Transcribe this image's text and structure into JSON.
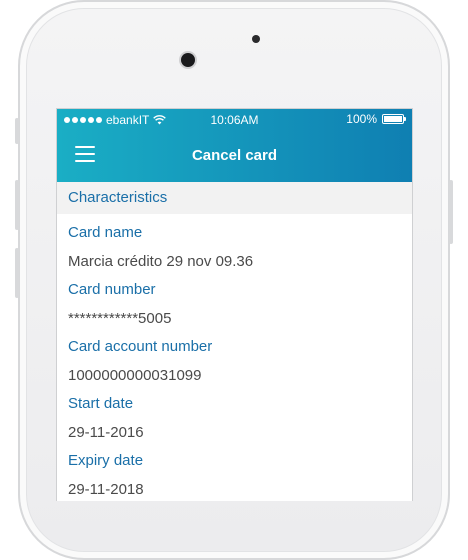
{
  "status_bar": {
    "carrier": "ebankIT",
    "time": "10:06AM",
    "battery_text": "100%",
    "signal_dots": 5,
    "battery_level": 1.0
  },
  "header": {
    "title": "Cancel card",
    "menu_icon": "hamburger-menu-icon",
    "background_color_start": "#1aaec5",
    "background_color_end": "#0f7fb2"
  },
  "section": {
    "title": "Characteristics"
  },
  "fields": [
    {
      "label": "Card name",
      "value": "Marcia crédito 29 nov 09.36"
    },
    {
      "label": "Card number",
      "value": "************5005"
    },
    {
      "label": "Card account number",
      "value": "1000000000031099"
    },
    {
      "label": "Start date",
      "value": "29-11-2016"
    },
    {
      "label": "Expiry date",
      "value": "29-11-2018"
    }
  ],
  "accent_color": "#1a6fa8"
}
